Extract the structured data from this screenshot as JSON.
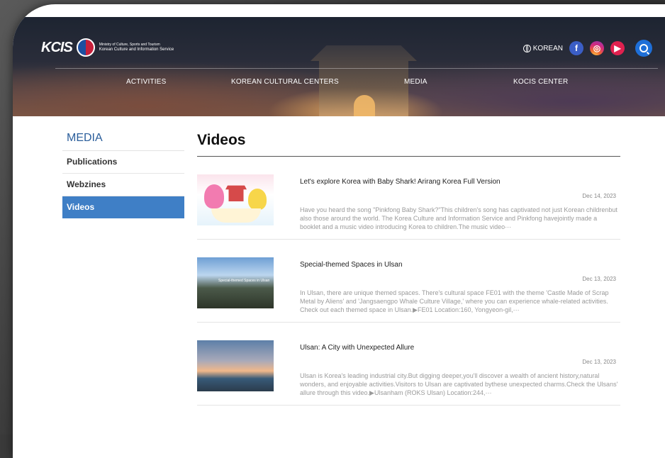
{
  "header": {
    "logo_text": "KCIS",
    "ministry": "Ministry of Culture, Sports and Tourism",
    "org_name": "Korean Culture and Information Service",
    "language": "KOREAN",
    "nav": [
      "ACTIVITIES",
      "KOREAN CULTURAL CENTERS",
      "MEDIA",
      "KOCIS CENTER"
    ],
    "social": {
      "facebook": "f",
      "instagram": "◎",
      "youtube": "▶"
    }
  },
  "sidebar": {
    "title": "MEDIA",
    "items": [
      {
        "label": "Publications"
      },
      {
        "label": "Webzines"
      },
      {
        "label": "Videos",
        "active": true
      }
    ]
  },
  "main": {
    "title": "Videos",
    "videos": [
      {
        "title": "Let's explore Korea with Baby Shark! Arirang Korea Full Version",
        "date": "Dec 14, 2023",
        "description": "Have you heard the song \"Pinkfong Baby Shark?\"This children's song has captivated not just Korean childrenbut also those around the world. The Korea Culture and Information Service and Pinkfong havejointly made a booklet and a music video introducing Korea to children.The music video···"
      },
      {
        "title": "Special-themed Spaces in Ulsan",
        "date": "Dec 13, 2023",
        "thumb_caption": "Special-themed Spaces in Ulsan",
        "description": "In Ulsan, there are unique themed spaces. There's cultural space FE01 with the theme 'Castle Made of Scrap Metal by Aliens' and 'Jangsaengpo Whale Culture Village,' where you can experience whale-related activities. Check out each themed space in Ulsan.▶FE01 Location:160, Yongyeon-gil,···"
      },
      {
        "title": "Ulsan: A City with Unexpected Allure",
        "date": "Dec 13, 2023",
        "description": "Ulsan is Korea's leading industrial city.But digging deeper,you'll discover a wealth of ancient history,natural wonders, and enjoyable activities.Visitors to Ulsan are captivated bythese unexpected charms.Check the Ulsans' allure through this video.▶Ulsanham (ROKS Ulsan) Location:244,···"
      }
    ]
  },
  "colors": {
    "accent": "#3f7fc6",
    "title_blue": "#2b5e9b",
    "search": "#1e6fd8"
  }
}
